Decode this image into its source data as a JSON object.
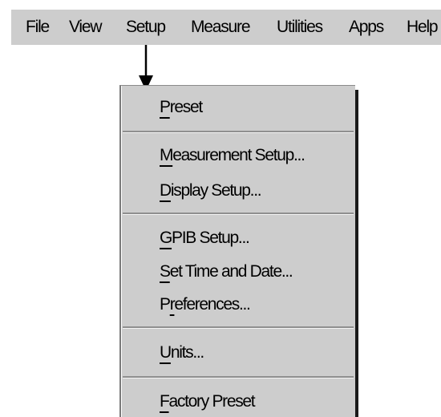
{
  "menubar": {
    "items": [
      {
        "label": "File"
      },
      {
        "label": "View"
      },
      {
        "label": "Setup"
      },
      {
        "label": "Measure"
      },
      {
        "label": "Utilities"
      },
      {
        "label": "Apps"
      },
      {
        "label": "Help"
      }
    ]
  },
  "setup_menu": {
    "items": [
      {
        "mnemonic": "P",
        "rest": "reset"
      },
      {
        "mnemonic": "M",
        "rest": "easurement Setup..."
      },
      {
        "mnemonic": "D",
        "rest": "isplay Setup..."
      },
      {
        "mnemonic": "G",
        "rest": "PIB Setup..."
      },
      {
        "mnemonic": "S",
        "rest": "et Time and Date..."
      },
      {
        "pre": "P",
        "mnemonic": "r",
        "rest": "eferences..."
      },
      {
        "mnemonic": "U",
        "rest": "nits..."
      },
      {
        "mnemonic": "F",
        "rest": "actory Preset"
      }
    ]
  }
}
